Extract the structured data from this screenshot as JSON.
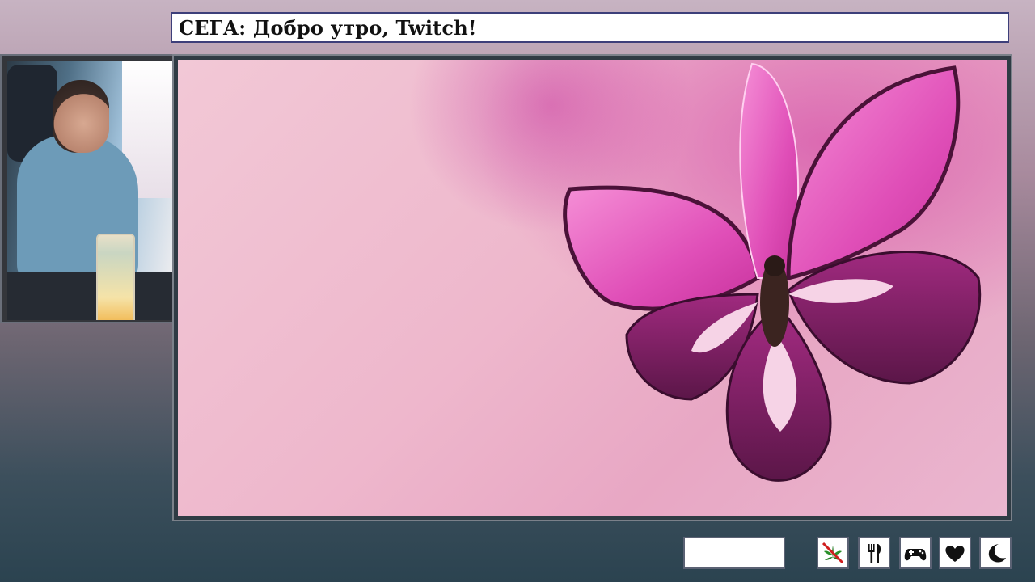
{
  "header": {
    "title": "СЕГА: Добро утро, Twitch!"
  },
  "status_box": {
    "text": ""
  },
  "status_icons": [
    {
      "name": "no-cannabis-icon"
    },
    {
      "name": "fork-knife-icon"
    },
    {
      "name": "gamepad-icon"
    },
    {
      "name": "heart-icon"
    },
    {
      "name": "moon-icon"
    }
  ],
  "colors": {
    "title_border": "#3d3f7a",
    "frame_border": "#7b818a",
    "butterfly_pink": "#e04fb8",
    "butterfly_dark": "#5b1648"
  }
}
